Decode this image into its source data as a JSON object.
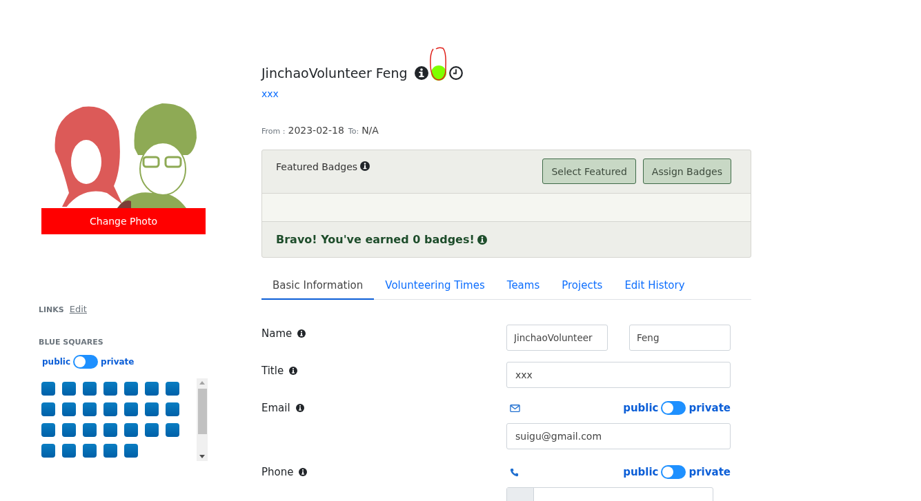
{
  "profile": {
    "change_photo_button": "Change Photo"
  },
  "links": {
    "heading": "LINKS",
    "edit_link": "Edit"
  },
  "blue_squares": {
    "heading": "BLUE SQUARES",
    "toggle": {
      "left_label": "public",
      "right_label": "private",
      "on": false
    },
    "squares": [
      {
        "kind": "square"
      },
      {
        "kind": "square"
      },
      {
        "kind": "square"
      },
      {
        "kind": "square"
      },
      {
        "kind": "square"
      },
      {
        "kind": "square"
      },
      {
        "kind": "square"
      },
      {
        "kind": "square"
      },
      {
        "kind": "square"
      },
      {
        "kind": "square"
      },
      {
        "kind": "square"
      },
      {
        "kind": "square"
      },
      {
        "kind": "square"
      },
      {
        "kind": "square"
      },
      {
        "kind": "square"
      },
      {
        "kind": "square"
      },
      {
        "kind": "square"
      },
      {
        "kind": "square"
      },
      {
        "kind": "square"
      },
      {
        "kind": "square"
      },
      {
        "kind": "square"
      },
      {
        "kind": "square"
      },
      {
        "kind": "square"
      },
      {
        "kind": "square"
      },
      {
        "kind": "square"
      },
      {
        "kind": "square"
      }
    ]
  },
  "header": {
    "name": "JinchaoVolunteer Feng",
    "status": {
      "active": true,
      "highlighted": true
    },
    "title": "xxx",
    "from_label": "From :",
    "from_date": "2023-02-18",
    "to_label": "To:",
    "to_date": "N/A"
  },
  "badges": {
    "title": "Featured Badges",
    "buttons": [
      "Select Featured",
      "Assign Badges"
    ],
    "earned_message": "Bravo! You've earned 0 badges!"
  },
  "tabs": [
    {
      "label": "Basic Information",
      "selected": true
    },
    {
      "label": "Volunteering Times",
      "selected": false
    },
    {
      "label": "Teams",
      "selected": false
    },
    {
      "label": "Projects",
      "selected": false
    },
    {
      "label": "Edit History",
      "selected": false
    }
  ],
  "form": [
    {
      "label": "Name",
      "kind": "name",
      "values": [
        "JinchaoVolunteer",
        "Feng"
      ]
    },
    {
      "label": "Title",
      "kind": "text",
      "value": "xxx"
    },
    {
      "label": "Email",
      "kind": "email",
      "toggle": {
        "left_label": "public",
        "right_label": "private",
        "on": false
      },
      "value": "suigu@gmail.com"
    },
    {
      "label": "Phone",
      "kind": "phone",
      "toggle": {
        "left_label": "public",
        "right_label": "private",
        "on": false
      }
    }
  ]
}
